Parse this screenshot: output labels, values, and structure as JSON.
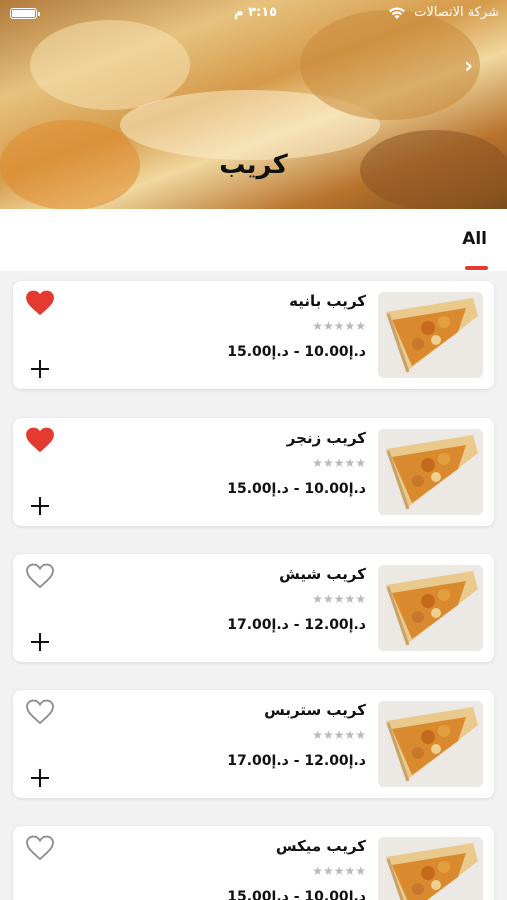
{
  "status_bar": {
    "carrier": "شركة الاتصالات",
    "time": "٣:١٥ م",
    "icons": [
      "battery-icon",
      "wifi-icon"
    ]
  },
  "hero": {
    "title": "كريب",
    "next_icon": "chevron-right-icon"
  },
  "tabs": [
    {
      "label": "All",
      "selected": true
    }
  ],
  "colors": {
    "accent": "#e43a2f",
    "favorite": "#e43a2f",
    "star_empty": "#b9b9b9"
  },
  "products": [
    {
      "name": "كريب بانيه",
      "stars": "★★★★★",
      "rating": 0,
      "price": "د.إ10.00 - د.إ15.00",
      "favorite": true,
      "image": "crepe-panne"
    },
    {
      "name": "كريب زنجر",
      "stars": "★★★★★",
      "rating": 0,
      "price": "د.إ10.00 - د.إ15.00",
      "favorite": true,
      "image": "crepe-zinger"
    },
    {
      "name": "كريب شيش",
      "stars": "★★★★★",
      "rating": 0,
      "price": "د.إ12.00 - د.إ17.00",
      "favorite": false,
      "image": "crepe-shish"
    },
    {
      "name": "كريب ستربس",
      "stars": "★★★★★",
      "rating": 0,
      "price": "د.إ12.00 - د.إ17.00",
      "favorite": false,
      "image": "crepe-strips"
    },
    {
      "name": "كريب ميكس",
      "stars": "★★★★★",
      "rating": 0,
      "price": "د.إ10.00 - د.إ15.00",
      "favorite": false,
      "image": "crepe-mix"
    }
  ]
}
